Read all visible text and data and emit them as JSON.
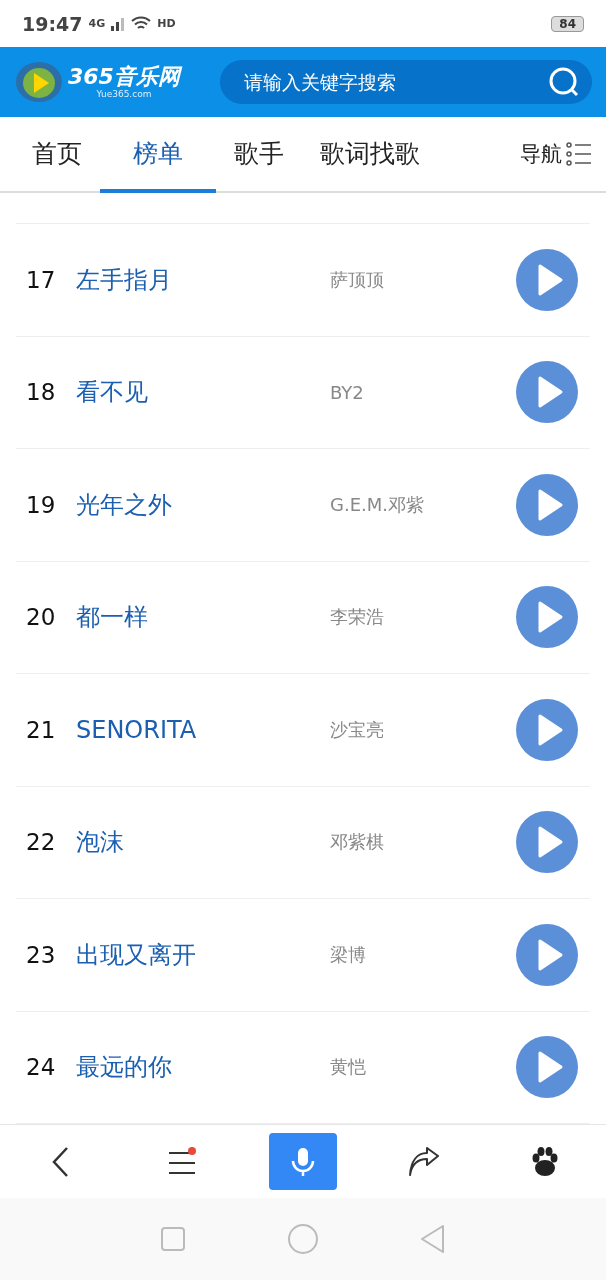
{
  "status_bar": {
    "time": "19:47",
    "network": "4G",
    "call": "HD",
    "battery": "84"
  },
  "header": {
    "logo_text": "365音乐网",
    "logo_sub": "Yue365.com",
    "search": {
      "placeholder": "请输入关键字搜索"
    }
  },
  "tabs": [
    {
      "label": "首页",
      "selected": false
    },
    {
      "label": "榜单",
      "selected": true
    },
    {
      "label": "歌手",
      "selected": false
    },
    {
      "label": "歌词找歌",
      "selected": false
    },
    {
      "label": "导航",
      "selected": false
    }
  ],
  "songs": [
    {
      "rank": "17",
      "title": "左手指月",
      "artist": "萨顶顶"
    },
    {
      "rank": "18",
      "title": "看不见",
      "artist": "BY2"
    },
    {
      "rank": "19",
      "title": "光年之外",
      "artist": "G.E.M.邓紫"
    },
    {
      "rank": "20",
      "title": "都一样",
      "artist": "李荣浩"
    },
    {
      "rank": "21",
      "title": "SENORITA",
      "artist": "沙宝亮"
    },
    {
      "rank": "22",
      "title": "泡沫",
      "artist": "邓紫棋"
    },
    {
      "rank": "23",
      "title": "出现又离开",
      "artist": "梁博"
    },
    {
      "rank": "24",
      "title": "最远的你",
      "artist": "黄恺"
    }
  ],
  "toolbar": {
    "menu_notification": true
  }
}
